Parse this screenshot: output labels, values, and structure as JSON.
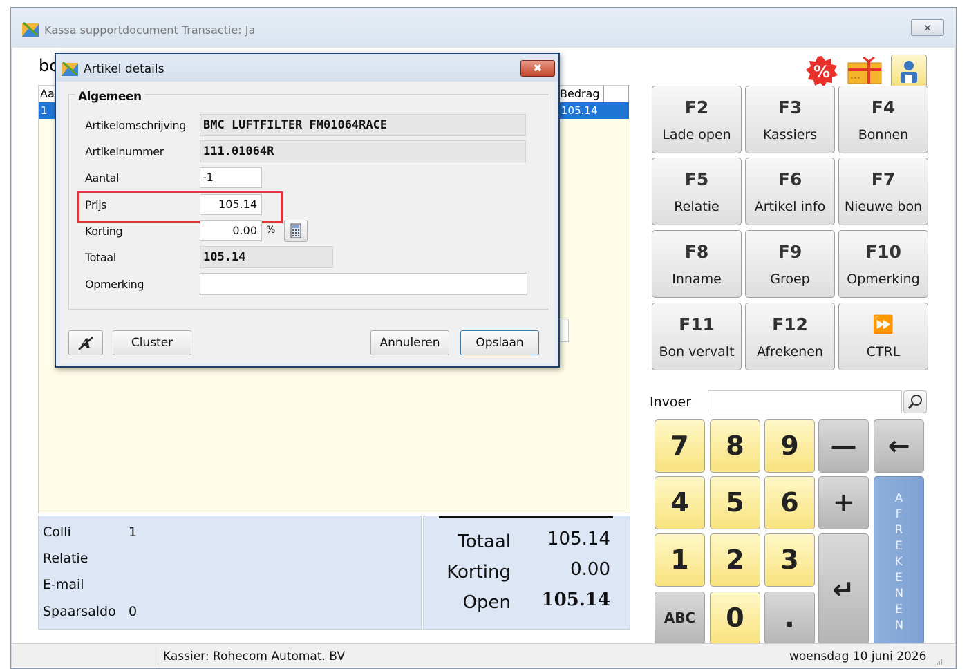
{
  "window": {
    "title": "Kassa supportdocument Transactie: Ja",
    "close": "⨯"
  },
  "main": {
    "label_partial": "bo",
    "list": {
      "headers": [
        "Aan",
        "Bedrag"
      ],
      "row": {
        "qty": "1",
        "amount": "105.14"
      }
    },
    "info": {
      "colli_label": "Colli",
      "colli_value": "1",
      "relatie_label": "Relatie",
      "email_label": "E-mail",
      "spaarsaldo_label": "Spaarsaldo",
      "spaarsaldo_value": "0"
    },
    "totals": {
      "totaal_label": "Totaal",
      "totaal_value": "105.14",
      "korting_label": "Korting",
      "korting_value": "0.00",
      "open_label": "Open",
      "open_value": "105.14"
    }
  },
  "function_keys": [
    {
      "key": "F2",
      "label": "Lade open"
    },
    {
      "key": "F3",
      "label": "Kassiers"
    },
    {
      "key": "F4",
      "label": "Bonnen"
    },
    {
      "key": "F5",
      "label": "Relatie"
    },
    {
      "key": "F6",
      "label": "Artikel info"
    },
    {
      "key": "F7",
      "label": "Nieuwe bon"
    },
    {
      "key": "F8",
      "label": "Inname"
    },
    {
      "key": "F9",
      "label": "Groep"
    },
    {
      "key": "F10",
      "label": "Opmerking"
    },
    {
      "key": "F11",
      "label": "Bon vervalt"
    },
    {
      "key": "F12",
      "label": "Afrekenen"
    },
    {
      "key": "⏩",
      "label": "CTRL"
    }
  ],
  "invoer": {
    "label": "Invoer",
    "value": ""
  },
  "numpad": {
    "k7": "7",
    "k8": "8",
    "k9": "9",
    "minus": "—",
    "back": "←",
    "k4": "4",
    "k5": "5",
    "k6": "6",
    "plus": "+",
    "k1": "1",
    "k2": "2",
    "k3": "3",
    "enter": "↵",
    "abc": "ABC",
    "k0": "0",
    "dot": ".",
    "afrekenen": "AFREKENEN"
  },
  "status": {
    "kassier": "Kassier: Rohecom Automat. BV",
    "date": "woensdag 10 juni 2026"
  },
  "dialog": {
    "title": "Artikel details",
    "close": "✖",
    "group_title": "Algemeen",
    "fields": {
      "omschrijving_label": "Artikelomschrijving",
      "omschrijving_value": "BMC LUFTFILTER FM01064RACE",
      "nummer_label": "Artikelnummer",
      "nummer_value": "111.01064R",
      "aantal_label": "Aantal",
      "aantal_value": "-1",
      "prijs_label": "Prijs",
      "prijs_value": "105.14",
      "korting_label": "Korting",
      "korting_value": "0.00",
      "korting_unit": "%",
      "totaal_label": "Totaal",
      "totaal_value": "105.14",
      "opmerking_label": "Opmerking",
      "opmerking_value": ""
    },
    "buttons": {
      "cluster": "Cluster",
      "annuleren": "Annuleren",
      "opslaan": "Opslaan"
    }
  },
  "colors": {
    "accent_blue": "#1f74d4",
    "highlight_red": "#e3343b",
    "key_yellow": "#f8e27e",
    "panel_blue": "#dce6f4"
  }
}
